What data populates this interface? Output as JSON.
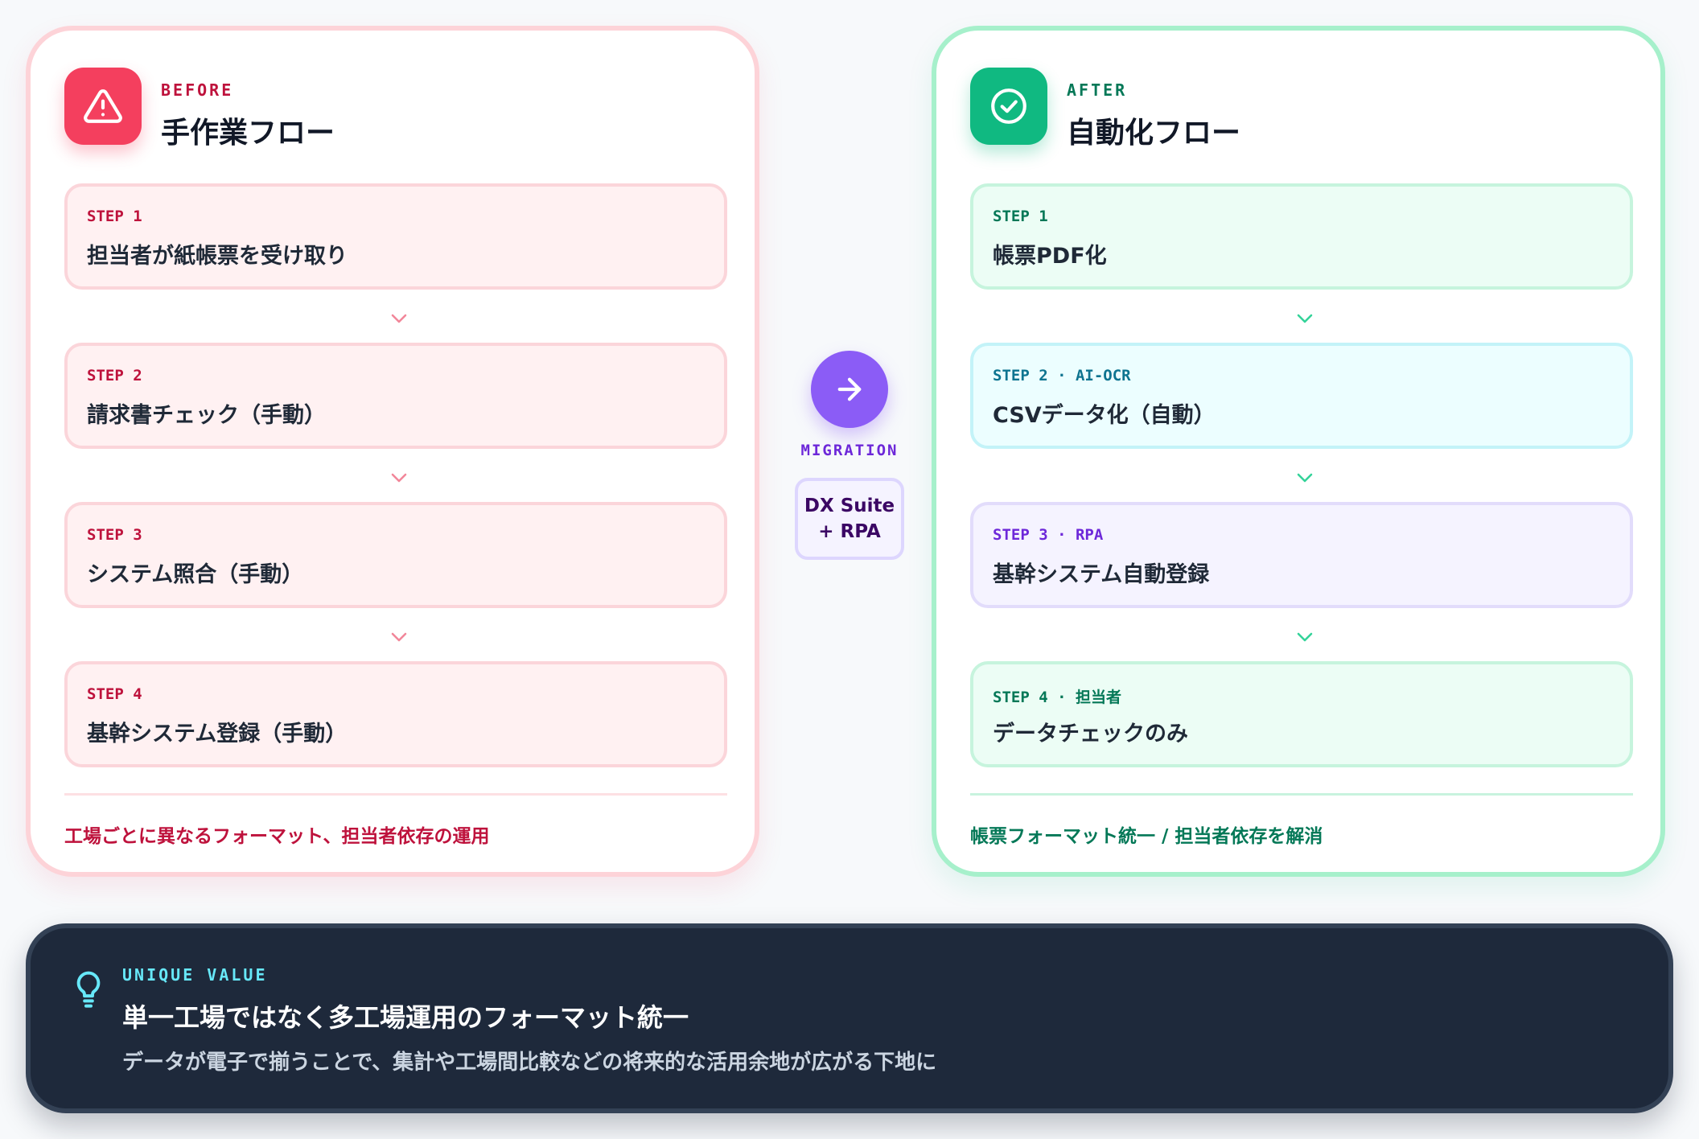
{
  "before": {
    "kicker": "BEFORE",
    "title": "手作業フロー",
    "icon": "warning-triangle-icon",
    "accent": "#f43f5e",
    "steps": [
      {
        "label": "STEP 1",
        "text": "担当者が紙帳票を受け取り"
      },
      {
        "label": "STEP 2",
        "text": "請求書チェック（手動）"
      },
      {
        "label": "STEP 3",
        "text": "システム照合（手動）"
      },
      {
        "label": "STEP 4",
        "text": "基幹システム登録（手動）"
      }
    ],
    "footer": "工場ごとに異なるフォーマット、担当者依存の運用"
  },
  "migration": {
    "icon": "arrow-right-icon",
    "label": "MIGRATION",
    "tool_line1": "DX Suite",
    "tool_line2": "+ RPA",
    "accent": "#8b5cf6"
  },
  "after": {
    "kicker": "AFTER",
    "title": "自動化フロー",
    "icon": "check-circle-icon",
    "accent": "#10b981",
    "steps": [
      {
        "label": "STEP 1",
        "text": "帳票PDF化"
      },
      {
        "label": "STEP 2 · AI-OCR",
        "text": "CSVデータ化（自動）"
      },
      {
        "label": "STEP 3 · RPA",
        "text": "基幹システム自動登録"
      },
      {
        "label": "STEP 4 · 担当者",
        "text": "データチェックのみ"
      }
    ],
    "footer": "帳票フォーマット統一 / 担当者依存を解消"
  },
  "value": {
    "icon": "lightbulb-icon",
    "kicker": "UNIQUE VALUE",
    "title": "単一工場ではなく多工場運用のフォーマット統一",
    "subtitle": "データが電子で揃うことで、集計や工場間比較などの将来的な活用余地が広がる下地に"
  }
}
